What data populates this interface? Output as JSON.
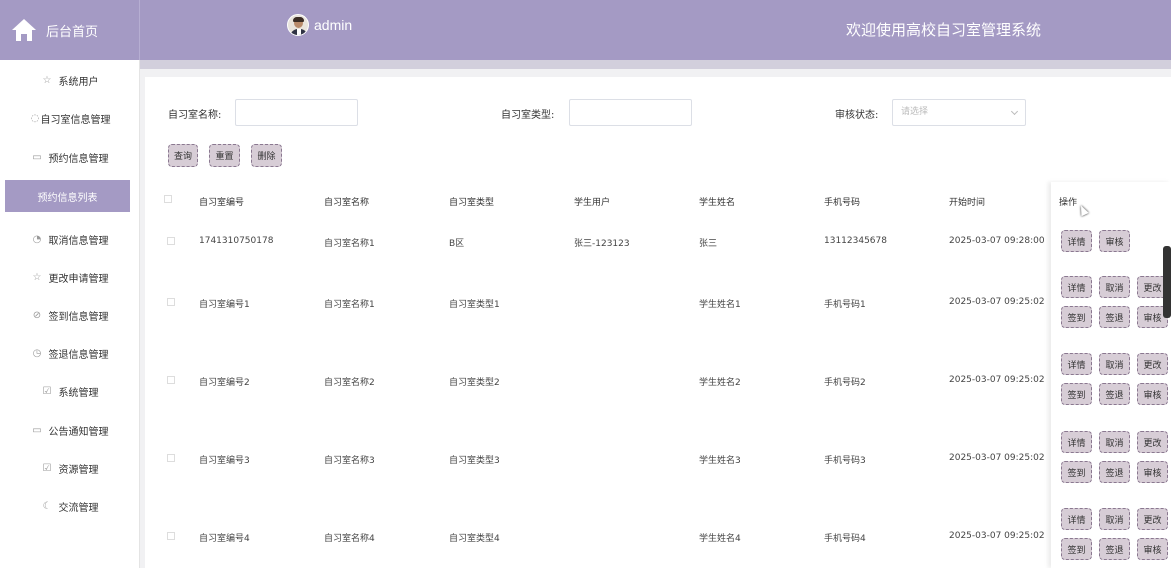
{
  "header": {
    "home_label": "后台首页",
    "user_name": "admin",
    "welcome": "欢迎使用高校自习室管理系统",
    "accent": "#a49ac4"
  },
  "sidebar": {
    "items": [
      {
        "label": "系统用户",
        "icon": "star-icon"
      },
      {
        "label": "自习室信息管理",
        "icon": "drop-icon"
      },
      {
        "label": "预约信息管理",
        "icon": "basket-icon"
      },
      {
        "label": "预约信息列表",
        "icon": "",
        "active": true
      },
      {
        "label": "取消信息管理",
        "icon": "clock-icon"
      },
      {
        "label": "更改申请管理",
        "icon": "star-icon"
      },
      {
        "label": "签到信息管理",
        "icon": "compass-icon"
      },
      {
        "label": "签退信息管理",
        "icon": "timer-icon"
      },
      {
        "label": "系统管理",
        "icon": "check-icon"
      },
      {
        "label": "公告通知管理",
        "icon": "basket-icon"
      },
      {
        "label": "资源管理",
        "icon": "check-icon"
      },
      {
        "label": "交流管理",
        "icon": "moon-icon"
      }
    ]
  },
  "search": {
    "room_name_label": "自习室名称:",
    "room_type_label": "自习室类型:",
    "status_label": "审核状态:",
    "status_placeholder": "请选择",
    "query_btn": "查询",
    "reset_btn": "重置",
    "delete_btn": "删除"
  },
  "table": {
    "headers": [
      "自习室编号",
      "自习室名称",
      "自习室类型",
      "学生用户",
      "学生姓名",
      "手机号码",
      "开始时间",
      "操作"
    ],
    "rows": [
      {
        "no": "1741310750178",
        "name": "自习室名称1",
        "type": "B区",
        "user": "张三-123123",
        "student": "张三",
        "phone": "13112345678",
        "time": "2025-03-07 09:28:00",
        "ops": [
          "详情",
          "审核"
        ]
      },
      {
        "no": "自习室编号1",
        "name": "自习室名称1",
        "type": "自习室类型1",
        "user": "",
        "student": "学生姓名1",
        "phone": "手机号码1",
        "time": "2025-03-07 09:25:02",
        "ops": [
          "详情",
          "取消",
          "更改",
          "签到",
          "签退",
          "审核"
        ]
      },
      {
        "no": "自习室编号2",
        "name": "自习室名称2",
        "type": "自习室类型2",
        "user": "",
        "student": "学生姓名2",
        "phone": "手机号码2",
        "time": "2025-03-07 09:25:02",
        "ops": [
          "详情",
          "取消",
          "更改",
          "签到",
          "签退",
          "审核"
        ]
      },
      {
        "no": "自习室编号3",
        "name": "自习室名称3",
        "type": "自习室类型3",
        "user": "",
        "student": "学生姓名3",
        "phone": "手机号码3",
        "time": "2025-03-07 09:25:02",
        "ops": [
          "详情",
          "取消",
          "更改",
          "签到",
          "签退",
          "审核"
        ]
      },
      {
        "no": "自习室编号4",
        "name": "自习室名称4",
        "type": "自习室类型4",
        "user": "",
        "student": "学生姓名4",
        "phone": "手机号码4",
        "time": "2025-03-07 09:25:02",
        "ops": [
          "详情",
          "取消",
          "更改",
          "签到",
          "签退",
          "审核"
        ]
      }
    ]
  }
}
